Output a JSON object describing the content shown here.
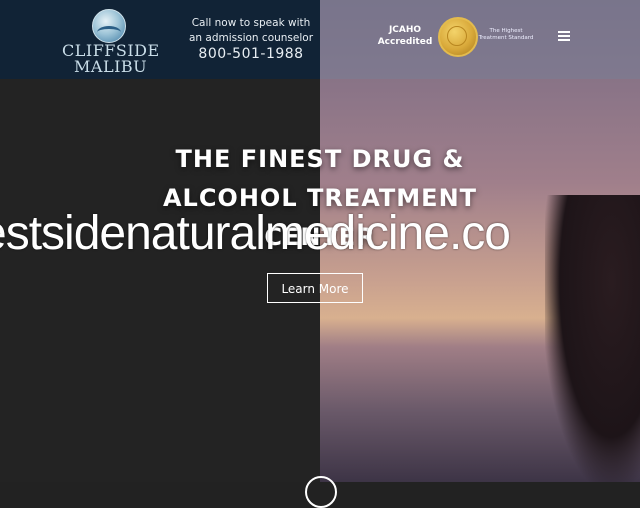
{
  "brand": {
    "line1": "CLIFFSIDE",
    "line2": "MALIBU"
  },
  "contact": {
    "line1": "Call now to speak with",
    "line2": "an admission counselor",
    "phone": "800-501-1988"
  },
  "accreditation": {
    "label_line1": "JCAHO",
    "label_line2": "Accredited",
    "tagline_line1": "The Highest",
    "tagline_line2": "Treatment Standard"
  },
  "hero": {
    "headline_line1": "THE FINEST DRUG &",
    "headline_line2": "ALCOHOL TREATMENT",
    "headline_line3": "CENTER",
    "cta_label": "Learn More"
  },
  "overlay": {
    "watermark": "estsidenaturalmedicine.co"
  },
  "icons": {
    "menu": "hamburger-icon",
    "scroll": "scroll-down-icon",
    "seal": "jcaho-seal-icon",
    "logo": "wave-emblem-icon"
  },
  "colors": {
    "header_left": "#112336",
    "left_panel": "#232323",
    "accent_gold": "#d9a93a"
  }
}
